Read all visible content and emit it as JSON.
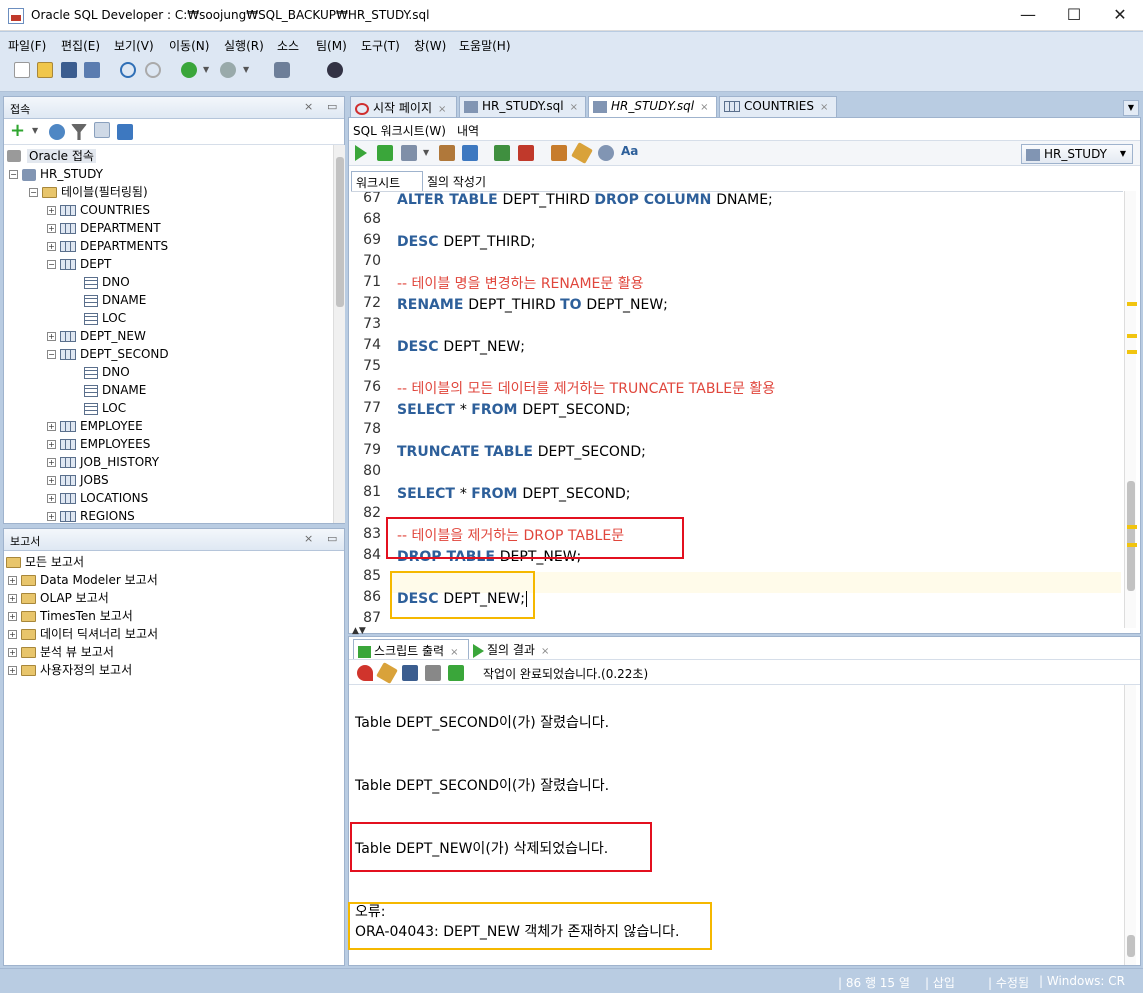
{
  "window": {
    "title": "Oracle SQL Developer : C:₩soojung₩SQL_BACKUP₩HR_STUDY.sql",
    "minimize": "—",
    "maximize": "☐",
    "close": "✕"
  },
  "menu": [
    "파일(F)",
    "편집(E)",
    "보기(V)",
    "이동(N)",
    "실행(R)",
    "소스",
    "팀(M)",
    "도구(T)",
    "창(W)",
    "도움말(H)"
  ],
  "connections": {
    "title": "접속",
    "root": "Oracle 접속",
    "connection": "HR_STUDY",
    "tables_folder": "테이블(필터링됨)",
    "tables": [
      "COUNTRIES",
      "DEPARTMENT",
      "DEPARTMENTS",
      "DEPT",
      "DNO",
      "DNAME",
      "LOC",
      "DEPT_NEW",
      "DEPT_SECOND",
      "DNO",
      "DNAME",
      "LOC",
      "EMPLOYEE",
      "EMPLOYEES",
      "JOB_HISTORY",
      "JOBS",
      "LOCATIONS",
      "REGIONS"
    ]
  },
  "reports": {
    "title": "보고서",
    "items": [
      "모든 보고서",
      "Data Modeler 보고서",
      "OLAP 보고서",
      "TimesTen 보고서",
      "데이터 딕셔너리 보고서",
      "분석 뷰 보고서",
      "사용자정의 보고서"
    ]
  },
  "doc_tabs": [
    "시작 페이지",
    "HR_STUDY.sql",
    "HR_STUDY.sql",
    "COUNTRIES"
  ],
  "editor": {
    "subtabs": [
      "SQL 워크시트(W)",
      "내역"
    ],
    "worksheet_tabs": [
      "워크시트",
      "질의 작성기"
    ],
    "connection_select": "HR_STUDY",
    "lines": [
      {
        "n": "67",
        "parts": [
          [
            "kw",
            "ALTER TABLE "
          ],
          [
            "tx",
            "DEPT_THIRD "
          ],
          [
            "kw",
            "DROP COLUMN "
          ],
          [
            "tx",
            "DNAME;"
          ]
        ]
      },
      {
        "n": "68",
        "parts": []
      },
      {
        "n": "69",
        "parts": [
          [
            "kw",
            "DESC "
          ],
          [
            "tx",
            "DEPT_THIRD;"
          ]
        ]
      },
      {
        "n": "70",
        "parts": []
      },
      {
        "n": "71",
        "parts": [
          [
            "cm",
            "-- 테이블 명을 변경하는 RENAME문 활용"
          ]
        ]
      },
      {
        "n": "72",
        "parts": [
          [
            "kw",
            "RENAME "
          ],
          [
            "tx",
            "DEPT_THIRD "
          ],
          [
            "kw",
            "TO "
          ],
          [
            "tx",
            "DEPT_NEW;"
          ]
        ]
      },
      {
        "n": "73",
        "parts": []
      },
      {
        "n": "74",
        "parts": [
          [
            "kw",
            "DESC "
          ],
          [
            "tx",
            "DEPT_NEW;"
          ]
        ]
      },
      {
        "n": "75",
        "parts": []
      },
      {
        "n": "76",
        "parts": [
          [
            "cm",
            "-- 테이블의 모든 데이터를 제거하는 TRUNCATE TABLE문 활용"
          ]
        ]
      },
      {
        "n": "77",
        "parts": [
          [
            "kw",
            "SELECT "
          ],
          [
            "tx",
            "* "
          ],
          [
            "kw",
            "FROM "
          ],
          [
            "tx",
            "DEPT_SECOND;"
          ]
        ]
      },
      {
        "n": "78",
        "parts": []
      },
      {
        "n": "79",
        "parts": [
          [
            "kw",
            "TRUNCATE TABLE "
          ],
          [
            "tx",
            "DEPT_SECOND;"
          ]
        ]
      },
      {
        "n": "80",
        "parts": []
      },
      {
        "n": "81",
        "parts": [
          [
            "kw",
            "SELECT "
          ],
          [
            "tx",
            "* "
          ],
          [
            "kw",
            "FROM "
          ],
          [
            "tx",
            "DEPT_SECOND;"
          ]
        ]
      },
      {
        "n": "82",
        "parts": []
      },
      {
        "n": "83",
        "parts": [
          [
            "cm",
            "-- 테이블을 제거하는 DROP TABLE문"
          ]
        ]
      },
      {
        "n": "84",
        "parts": [
          [
            "kw",
            "DROP TABLE "
          ],
          [
            "tx",
            "DEPT_NEW;"
          ]
        ]
      },
      {
        "n": "85",
        "parts": []
      },
      {
        "n": "86",
        "parts": [
          [
            "kw",
            "DESC "
          ],
          [
            "tx",
            "DEPT_NEW;"
          ]
        ]
      },
      {
        "n": "87",
        "parts": []
      }
    ]
  },
  "output": {
    "tabs": [
      "스크립트 출력",
      "질의 결과"
    ],
    "status": "작업이 완료되었습니다.(0.22초)",
    "lines": [
      "Table DEPT_SECOND이(가) 잘렸습니다.",
      "Table DEPT_SECOND이(가) 잘렸습니다.",
      "Table DEPT_NEW이(가) 삭제되었습니다.",
      "오류:",
      "ORA-04043: DEPT_NEW 객체가 존재하지 않습니다."
    ]
  },
  "statusbar": {
    "position": "86 행 15 열",
    "insert": "삽입",
    "modified": "수정됨",
    "os": "Windows: CR"
  },
  "colors": {
    "keyword": "#2d5f9a",
    "comment": "#e0463c",
    "highlight_red": "#e3101f",
    "highlight_yellow": "#f5b800"
  }
}
